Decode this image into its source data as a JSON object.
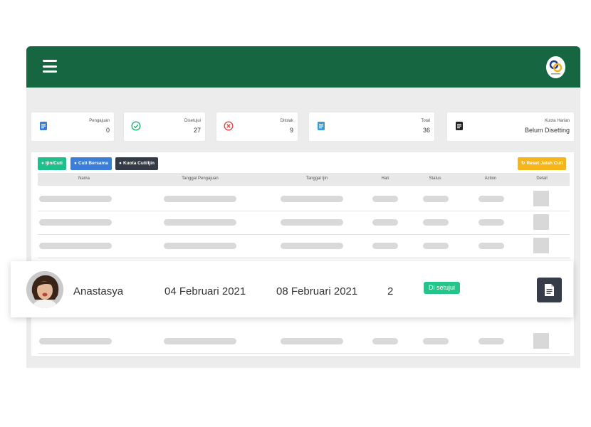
{
  "stats": [
    {
      "label": "Pengajuan",
      "value": "0",
      "icon": "document-icon",
      "color": "#3a7bd5"
    },
    {
      "label": "Disetujui",
      "value": "27",
      "icon": "check-circle-icon",
      "color": "#22b573"
    },
    {
      "label": "Ditolak",
      "value": "9",
      "icon": "x-circle-icon",
      "color": "#e64646"
    },
    {
      "label": "Total",
      "value": "36",
      "icon": "document-icon",
      "color": "#3a9bd5"
    },
    {
      "label": "Kuota Harian",
      "value": "Belum Disetting",
      "icon": "note-icon",
      "color": "#222222"
    }
  ],
  "toolbar": {
    "izin_cuti": "Ijin/Cuti",
    "cuti_bersama": "Cuti Bersama",
    "kuota_cuti": "Kuota Cuti/Ijin",
    "reset": "Reset Jatah Cuti"
  },
  "table": {
    "headers": [
      "Nama",
      "Tanggal Pengajuan",
      "Tanggal Ijin",
      "Hari",
      "Status",
      "Action",
      "Detail"
    ]
  },
  "highlight_row": {
    "name": "Anastasya",
    "tanggal_pengajuan": "04 Februari 2021",
    "tanggal_ijin": "08 Februari 2021",
    "hari": "2",
    "status": "Di setujui",
    "status_color": "#22c58a"
  }
}
